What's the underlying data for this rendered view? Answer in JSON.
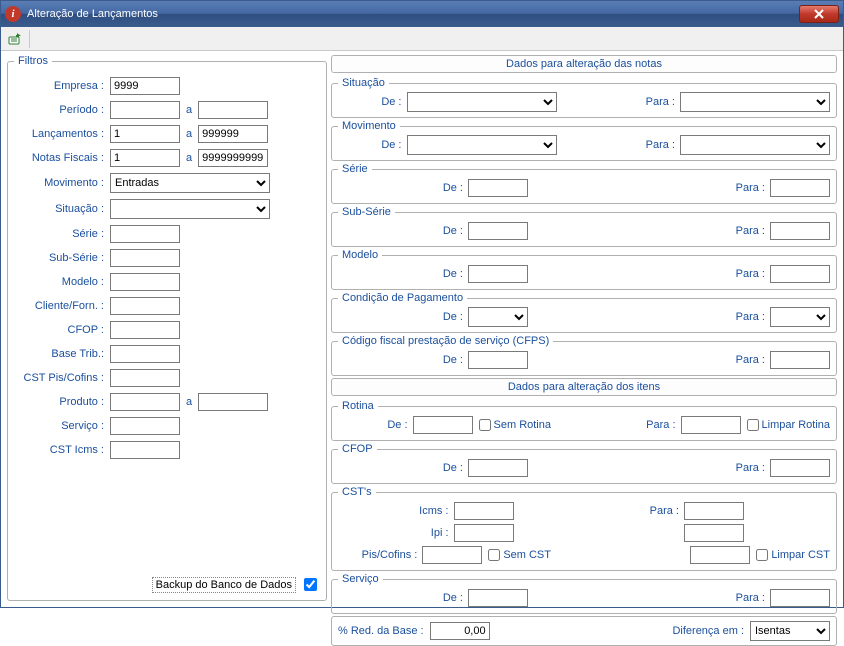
{
  "window": {
    "title": "Alteração de Lançamentos"
  },
  "filters": {
    "legend": "Filtros",
    "empresa_label": "Empresa :",
    "empresa_value": "9999",
    "periodo_label": "Período :",
    "periodo_from": "",
    "periodo_mid": "a",
    "periodo_to": "",
    "lanc_label": "Lançamentos :",
    "lanc_from": "1",
    "lanc_mid": "a",
    "lanc_to": "999999",
    "nf_label": "Notas Fiscais :",
    "nf_from": "1",
    "nf_mid": "a",
    "nf_to": "9999999999",
    "mov_label": "Movimento :",
    "mov_value": "Entradas",
    "sit_label": "Situação :",
    "sit_value": "",
    "serie_label": "Série :",
    "serie_value": "",
    "subserie_label": "Sub-Série :",
    "subserie_value": "",
    "modelo_label": "Modelo :",
    "modelo_value": "",
    "cliente_label": "Cliente/Forn. :",
    "cliente_value": "",
    "cfop_label": "CFOP :",
    "cfop_value": "",
    "basetrib_label": "Base Trib.:",
    "basetrib_value": "",
    "cstpis_label": "CST Pis/Cofins :",
    "cstpis_value": "",
    "produto_label": "Produto :",
    "produto_from": "",
    "produto_mid": "a",
    "produto_to": "",
    "servico_label": "Serviço :",
    "servico_value": "",
    "csticms_label": "CST Icms :",
    "csticms_value": "",
    "backup_label": "Backup do Banco de Dados"
  },
  "notas": {
    "header": "Dados para alteração das notas",
    "situacao": {
      "legend": "Situação",
      "de_label": "De :",
      "de": "",
      "para_label": "Para :",
      "para": ""
    },
    "movimento": {
      "legend": "Movimento",
      "de_label": "De :",
      "de": "",
      "para_label": "Para :",
      "para": ""
    },
    "serie": {
      "legend": "Série",
      "de_label": "De :",
      "de": "",
      "para_label": "Para :",
      "para": ""
    },
    "subserie": {
      "legend": "Sub-Série",
      "de_label": "De :",
      "de": "",
      "para_label": "Para :",
      "para": ""
    },
    "modelo": {
      "legend": "Modelo",
      "de_label": "De :",
      "de": "",
      "para_label": "Para :",
      "para": ""
    },
    "condpag": {
      "legend": "Condição de Pagamento",
      "de_label": "De :",
      "de": "",
      "para_label": "Para :",
      "para": ""
    },
    "cfps": {
      "legend": "Código fiscal prestação de serviço (CFPS)",
      "de_label": "De :",
      "de": "",
      "para_label": "Para :",
      "para": ""
    }
  },
  "itens": {
    "header": "Dados para alteração dos itens",
    "rotina": {
      "legend": "Rotina",
      "de_label": "De :",
      "de": "",
      "semrotina_label": "Sem Rotina",
      "para_label": "Para :",
      "para": "",
      "limpar_label": "Limpar Rotina"
    },
    "cfop": {
      "legend": "CFOP",
      "de_label": "De :",
      "de": "",
      "para_label": "Para :",
      "para": ""
    },
    "csts": {
      "legend": "CST's",
      "icms_label": "Icms :",
      "icms_de": "",
      "icms_para_label": "Para :",
      "icms_para": "",
      "ipi_label": "Ipi :",
      "ipi_de": "",
      "ipi_para": "",
      "pis_label": "Pis/Cofins :",
      "pis_de": "",
      "semcst_label": "Sem CST",
      "pis_para": "",
      "limparcst_label": "Limpar CST"
    },
    "servico": {
      "legend": "Serviço",
      "de_label": "De :",
      "de": "",
      "para_label": "Para :",
      "para": ""
    },
    "redbase_label": "% Red. da Base :",
    "redbase_value": "0,00",
    "dif_label": "Diferença em :",
    "dif_value": "Isentas"
  }
}
